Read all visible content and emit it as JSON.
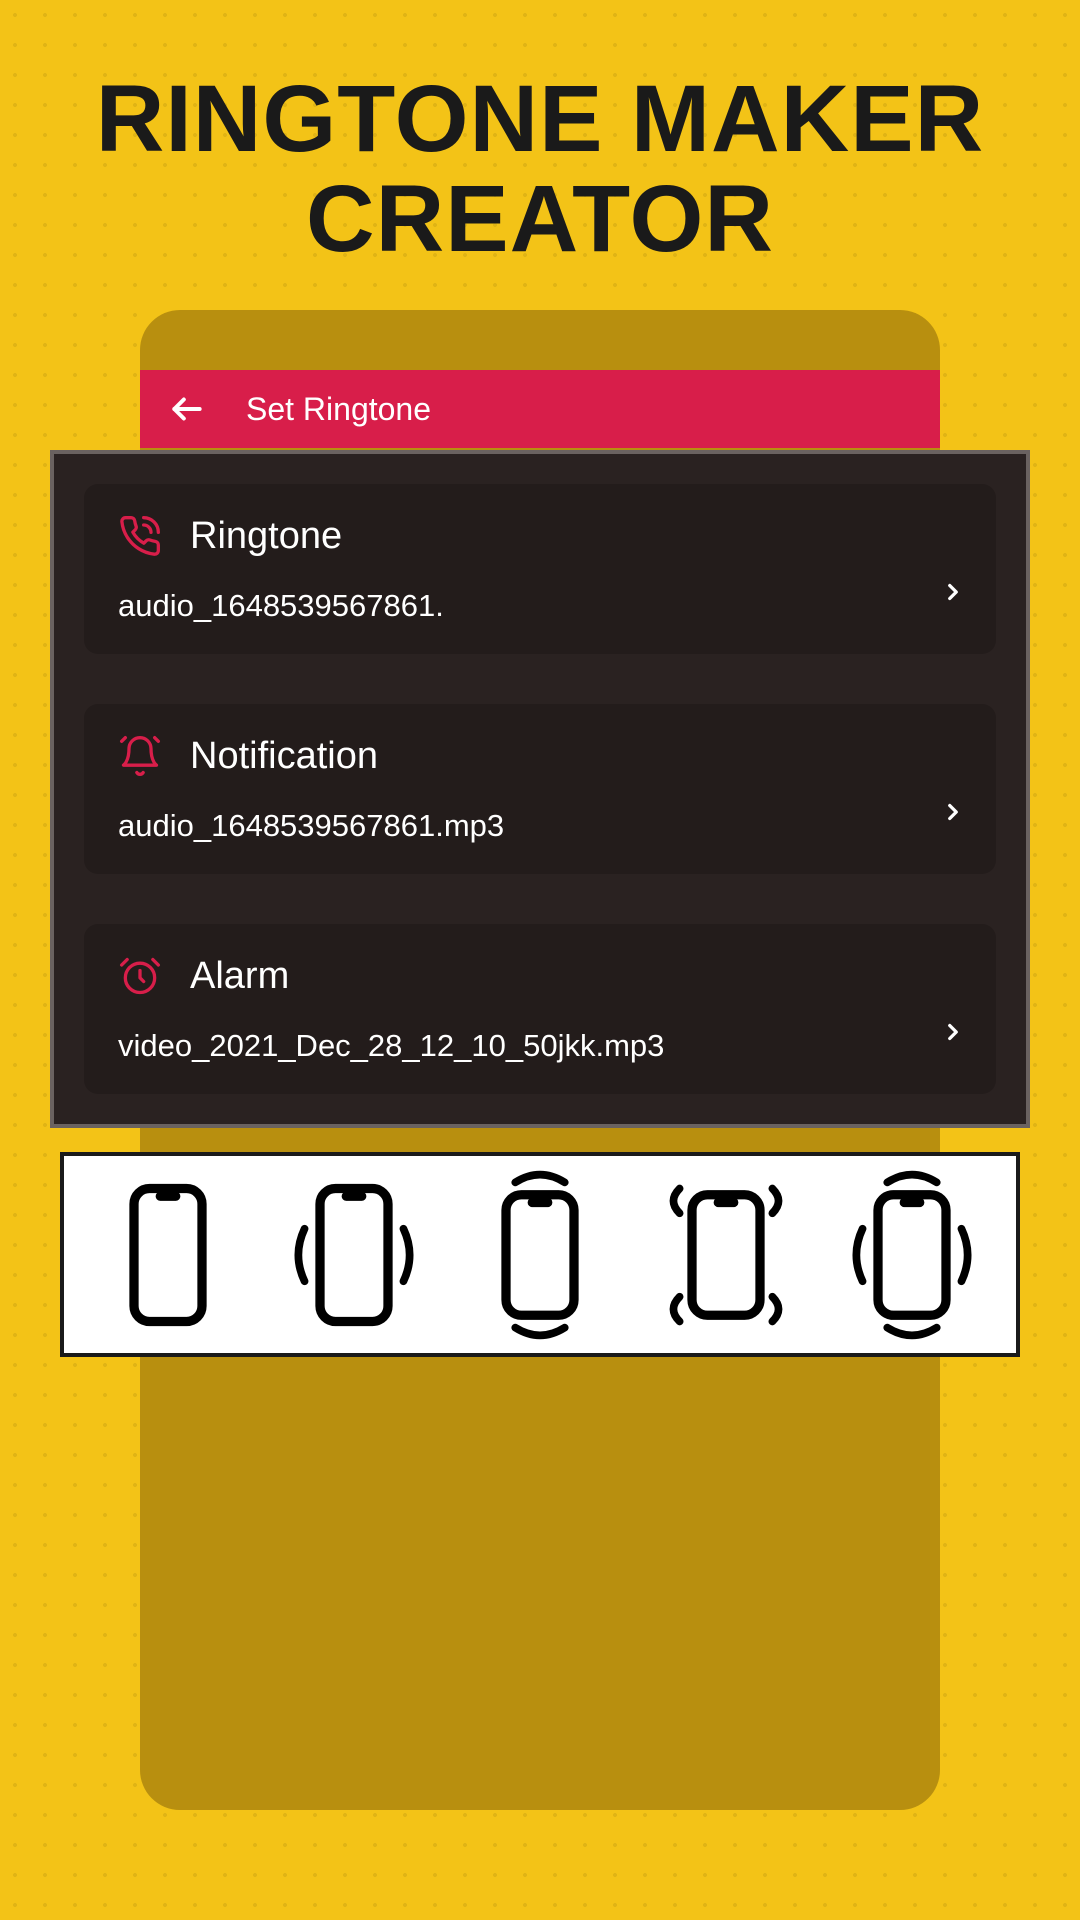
{
  "hero": {
    "line1": "RINGTONE MAKER",
    "line2": "CREATOR"
  },
  "appbar": {
    "title": "Set Ringtone"
  },
  "settings": {
    "ringtone": {
      "label": "Ringtone",
      "value": "audio_1648539567861."
    },
    "notification": {
      "label": "Notification",
      "value": "audio_1648539567861.mp3"
    },
    "alarm": {
      "label": "Alarm",
      "value": "video_2021_Dec_28_12_10_50jkk.mp3"
    }
  },
  "colors": {
    "accent": "#d81e4a",
    "bg": "#f3c317",
    "card": "#231c1b"
  }
}
